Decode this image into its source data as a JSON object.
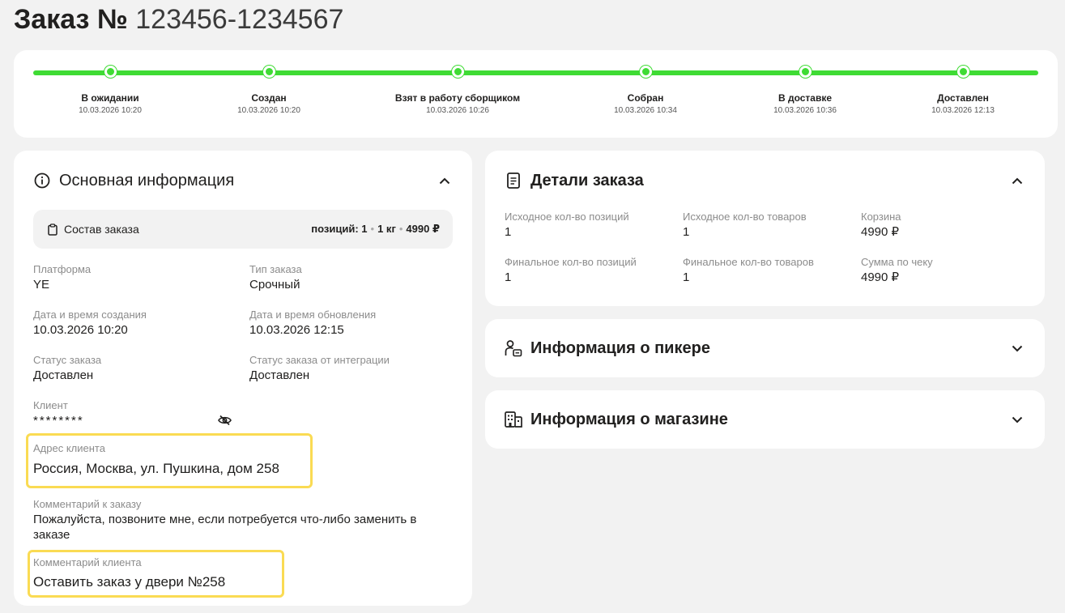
{
  "header": {
    "prefix": "Заказ №",
    "number": "123456-1234567"
  },
  "timeline": {
    "color": "#3fdb34",
    "steps": [
      {
        "label": "В ожидании",
        "date": "10.03.2026 10:20"
      },
      {
        "label": "Создан",
        "date": "10.03.2026 10:20"
      },
      {
        "label": "Взят в работу сборщиком",
        "date": "10.03.2026 10:26"
      },
      {
        "label": "Собран",
        "date": "10.03.2026 10:34"
      },
      {
        "label": "В доставке",
        "date": "10.03.2026 10:36"
      },
      {
        "label": "Доставлен",
        "date": "10.03.2026 12:13"
      }
    ]
  },
  "main_info": {
    "title": "Основная информация",
    "composition": {
      "label": "Состав заказа",
      "positions": "позиций: 1",
      "weight": "1 кг",
      "price": "4990 ₽",
      "sep": "•"
    },
    "platform": {
      "label": "Платформа",
      "value": "YE"
    },
    "order_type": {
      "label": "Тип заказа",
      "value": "Срочный"
    },
    "created": {
      "label": "Дата и время создания",
      "value": "10.03.2026 10:20"
    },
    "updated": {
      "label": "Дата и время обновления",
      "value": "10.03.2026 12:15"
    },
    "status": {
      "label": "Статус заказа",
      "value": "Доставлен"
    },
    "status_integration": {
      "label": "Статус заказа от интеграции",
      "value": "Доставлен"
    },
    "client": {
      "label": "Клиент",
      "value": "********"
    },
    "address": {
      "label": "Адрес клиента",
      "value": "Россия, Москва, ул. Пушкина, дом 258"
    },
    "order_comment": {
      "label": "Комментарий к заказу",
      "value": "Пожалуйста, позвоните мне, если потребуется что-либо заменить в заказе"
    },
    "client_comment": {
      "label": "Комментарий клиента",
      "value": "Оставить заказ у двери №258"
    },
    "highlight_color": "#fadb53"
  },
  "details": {
    "title": "Детали заказа",
    "initial_positions": {
      "label": "Исходное кол-во позиций",
      "value": "1"
    },
    "initial_items": {
      "label": "Исходное кол-во товаров",
      "value": "1"
    },
    "cart": {
      "label": "Корзина",
      "value": "4990 ₽"
    },
    "final_positions": {
      "label": "Финальное кол-во позиций",
      "value": "1"
    },
    "final_items": {
      "label": "Финальное кол-во товаров",
      "value": "1"
    },
    "receipt_total": {
      "label": "Сумма по чеку",
      "value": "4990 ₽"
    }
  },
  "picker": {
    "title": "Информация о пикере"
  },
  "shop": {
    "title": "Информация о магазине"
  },
  "icons": {
    "main_info": "info-icon",
    "composition": "clipboard-icon",
    "client_visibility": "eye-off-icon",
    "details": "document-icon",
    "picker": "person-badge-icon",
    "shop": "building-icon",
    "collapse": "chevron-up-icon",
    "expand": "chevron-down-icon"
  }
}
